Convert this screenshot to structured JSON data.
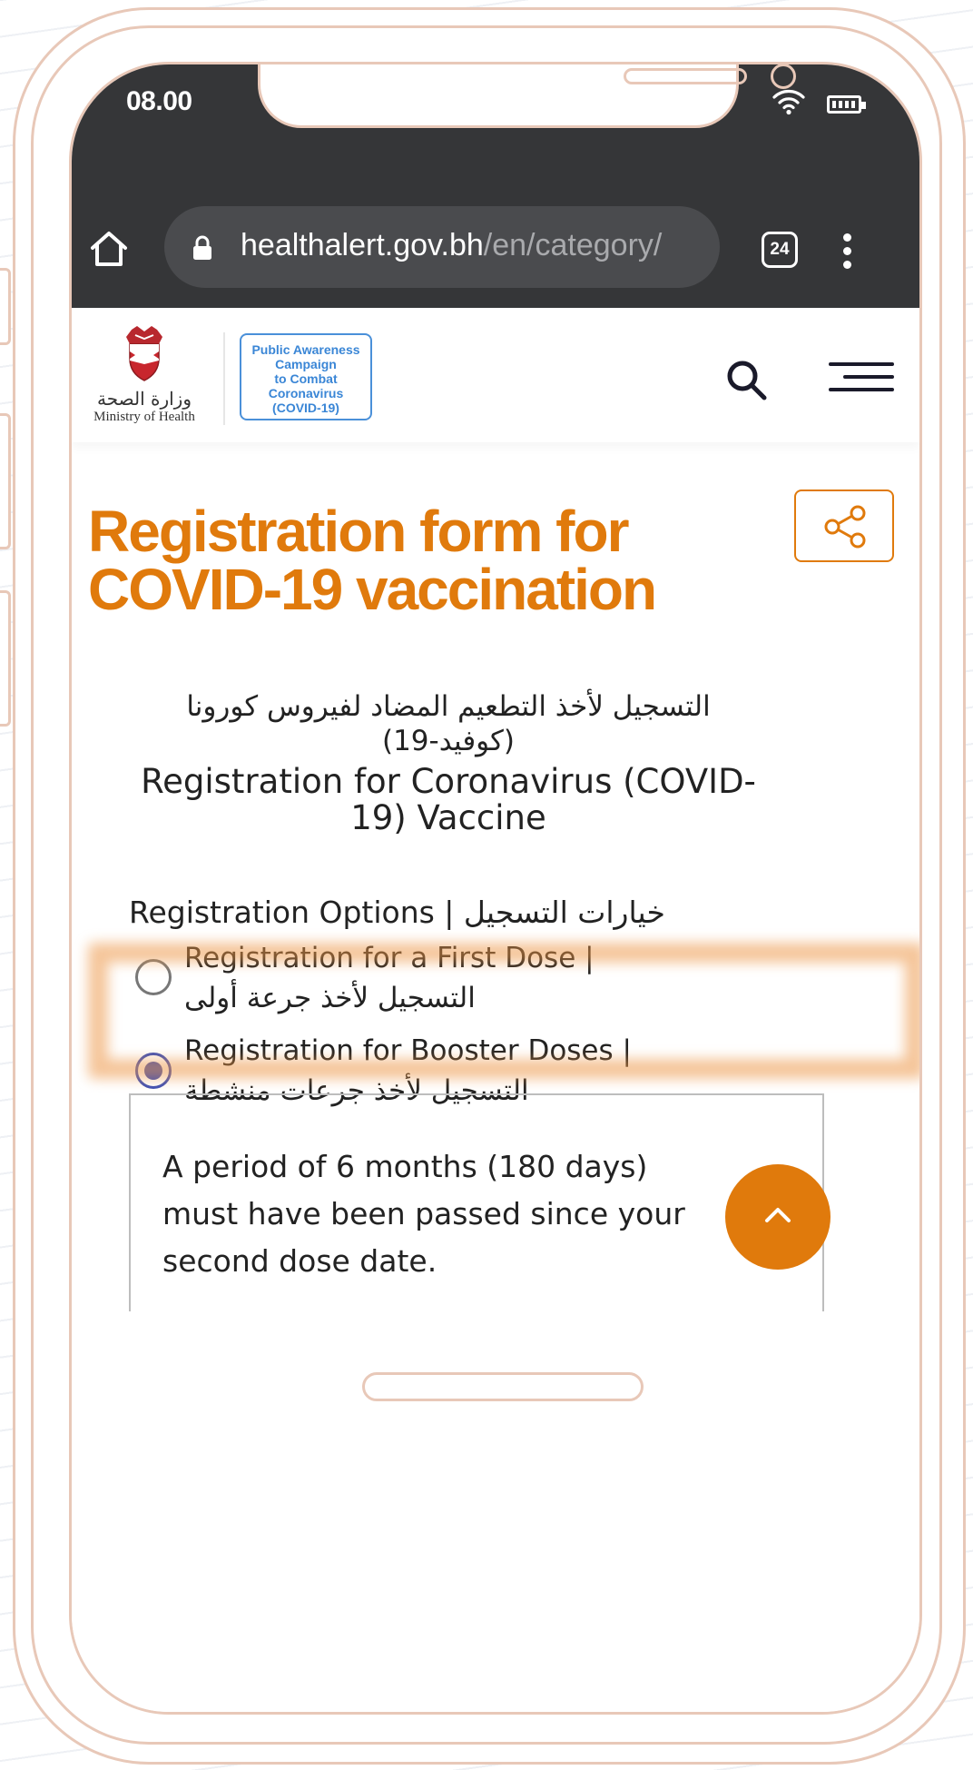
{
  "status_bar": {
    "time": "08.00",
    "battery_icon": "battery-icon",
    "wifi_icon": "wifi-icon"
  },
  "browser": {
    "url_host": "healthalert.gov.bh",
    "url_path": "/en/category/",
    "tab_count": "24"
  },
  "site_header": {
    "moh_ar": "وزارة الصحة",
    "moh_en": "Ministry of Health",
    "campaign_lines": [
      "Public Awareness",
      "Campaign",
      "to Combat",
      "Coronavirus",
      "(COVID-19)"
    ]
  },
  "page": {
    "title_line1": "Registration form for",
    "title_line2": "COVID-19 vaccination"
  },
  "form": {
    "title_ar": "التسجيل لأخذ التطعيم المضاد لفيروس كورونا (كوفيد-19)",
    "title_en": "Registration for Coronavirus (COVID-19) Vaccine",
    "options_label": "Registration Options | خيارات التسجيل",
    "options": [
      {
        "label": "Registration for a First Dose | التسجيل لأخذ جرعة أولى",
        "selected": false
      },
      {
        "label": "Registration for Booster Doses | التسجيل لأخذ جرعات منشطة",
        "selected": true
      }
    ],
    "info_text": "A period of 6 months (180 days) must have been passed since your second dose date."
  },
  "colors": {
    "accent": "#e07a0c",
    "radio_selected": "#3f51b5",
    "browser_bar": "#353638"
  }
}
